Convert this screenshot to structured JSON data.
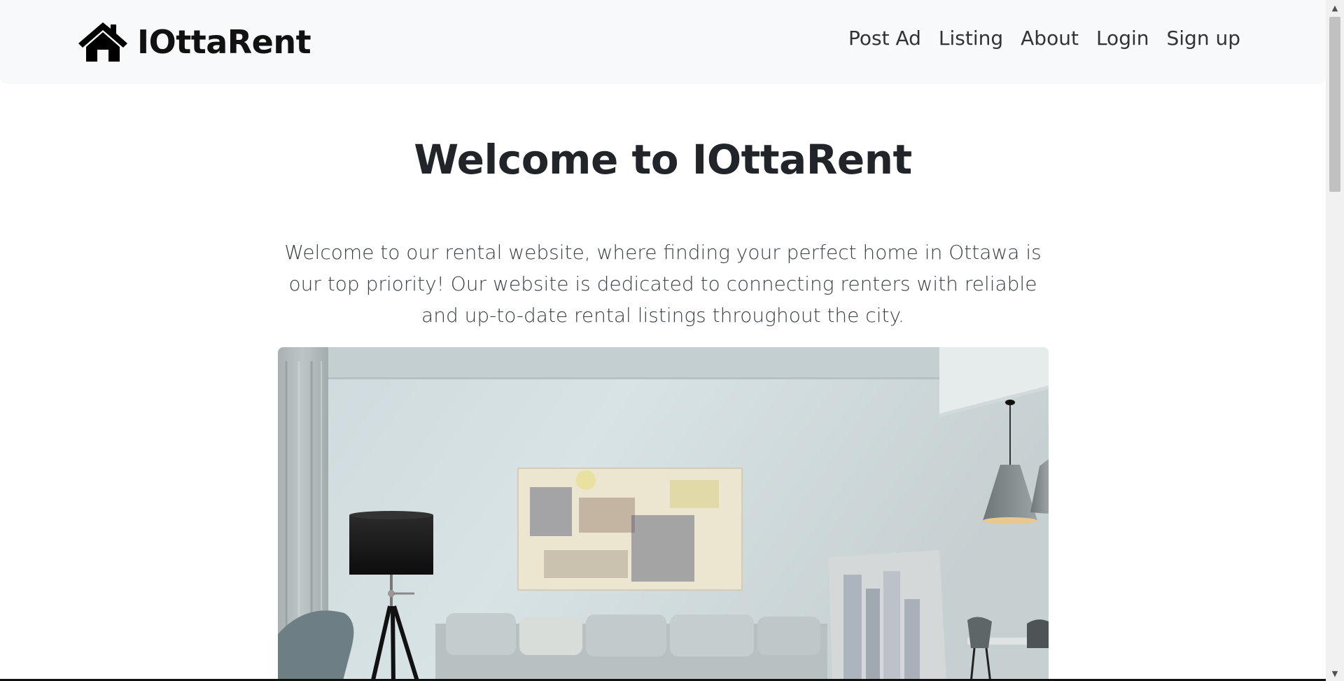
{
  "navbar": {
    "brand": "IOttaRent",
    "brand_icon": "house-icon",
    "links": [
      {
        "label": "Post Ad"
      },
      {
        "label": "Listing"
      },
      {
        "label": "About"
      },
      {
        "label": "Login"
      },
      {
        "label": "Sign up"
      }
    ]
  },
  "main": {
    "title": "Welcome to IOttaRent",
    "intro": "Welcome to our rental website, where finding your perfect home in Ottawa is our top priority! Our website is dedicated to connecting renters with reliable and up-to-date rental listings throughout the city.",
    "hero_image": "living-room-photo"
  },
  "scrollbar": {
    "up_icon": "chevron-up-icon",
    "down_icon": "chevron-down-icon"
  }
}
